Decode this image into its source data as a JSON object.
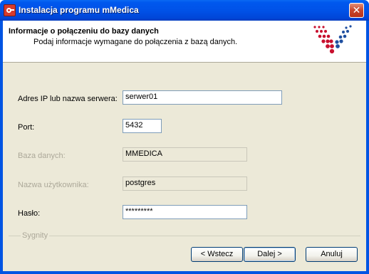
{
  "window": {
    "title": "Instalacja programu mMedica",
    "close_glyph": "✕",
    "icon": "mmedica-app-icon"
  },
  "header": {
    "title": "Informacje o połączeniu do bazy danych",
    "subtitle": "Podaj informacje wymagane do połączenia z bazą danych.",
    "logo": "sygnity-logo"
  },
  "form": {
    "server": {
      "label": "Adres IP lub nazwa serwera:",
      "value": "serwer01"
    },
    "port": {
      "label": "Port:",
      "value": "5432"
    },
    "database": {
      "label": "Baza danych:",
      "value": "MMEDICA"
    },
    "username": {
      "label": "Nazwa użytkownika:",
      "value": "postgres"
    },
    "password": {
      "label": "Hasło:",
      "value": "*********"
    }
  },
  "footer": {
    "brand": "Sygnity",
    "back_label": "< Wstecz",
    "next_label": "Dalej >",
    "cancel_label": "Anuluj"
  },
  "colors": {
    "titlebar": "#0054e3",
    "logo_red": "#c8102e",
    "logo_blue": "#1f4fa0"
  }
}
